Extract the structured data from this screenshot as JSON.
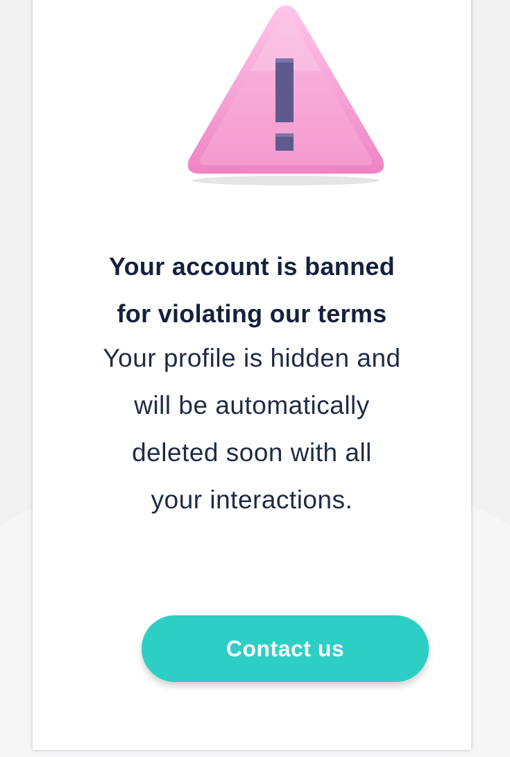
{
  "dialog": {
    "icon": "warning-triangle-icon",
    "title_lines": [
      "Your account is banned",
      "for violating our terms"
    ],
    "body_lines": [
      "Your profile is hidden and",
      "will be automatically",
      "deleted soon with all",
      "your interactions."
    ],
    "contact_button_label": "Contact us"
  },
  "colors": {
    "accent": "#2dcfc5",
    "title_text": "#14213d",
    "warning_fill": "#f7a6d6",
    "exclamation": "#5e5a8e"
  }
}
